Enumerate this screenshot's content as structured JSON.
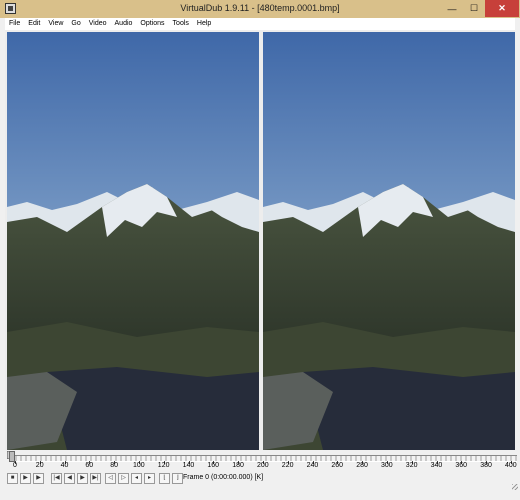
{
  "window": {
    "title": "VirtualDub 1.9.11 - [480temp.0001.bmp]",
    "minimize_glyph": "—",
    "maximize_glyph": "☐",
    "close_glyph": "✕"
  },
  "menu": [
    {
      "label": "File"
    },
    {
      "label": "Edit"
    },
    {
      "label": "View"
    },
    {
      "label": "Go"
    },
    {
      "label": "Video"
    },
    {
      "label": "Audio"
    },
    {
      "label": "Options"
    },
    {
      "label": "Tools"
    },
    {
      "label": "Help"
    }
  ],
  "panes": [
    {
      "name": "input-pane",
      "content": "mountain-lake-landscape"
    },
    {
      "name": "output-pane",
      "content": "mountain-lake-landscape"
    }
  ],
  "timeline": {
    "current_frame": 0,
    "max_frame": 400,
    "tick_labels": [
      "0",
      "20",
      "40",
      "60",
      "80",
      "100",
      "120",
      "140",
      "160",
      "180",
      "200",
      "220",
      "240",
      "260",
      "280",
      "300",
      "320",
      "340",
      "360",
      "380",
      "400"
    ]
  },
  "status": {
    "frame_text": "Frame 0 (0:00:00.000) [K]"
  },
  "toolbar": {
    "buttons": [
      {
        "name": "stop-button",
        "icon": "stop-icon",
        "glyph": "■"
      },
      {
        "name": "play-input-button",
        "icon": "play-input-icon",
        "glyph": "▶"
      },
      {
        "name": "play-output-button",
        "icon": "play-output-icon",
        "glyph": "▶"
      },
      {
        "name": "go-start-button",
        "icon": "go-start-icon",
        "glyph": "|◀"
      },
      {
        "name": "prev-frame-button",
        "icon": "prev-frame-icon",
        "glyph": "◀"
      },
      {
        "name": "next-frame-button",
        "icon": "next-frame-icon",
        "glyph": "▶"
      },
      {
        "name": "go-end-button",
        "icon": "go-end-icon",
        "glyph": "▶|"
      },
      {
        "name": "prev-key-button",
        "icon": "prev-key-icon",
        "glyph": "◁"
      },
      {
        "name": "next-key-button",
        "icon": "next-key-icon",
        "glyph": "▷"
      },
      {
        "name": "scene-rev-button",
        "icon": "scene-rev-icon",
        "glyph": "◂"
      },
      {
        "name": "scene-fwd-button",
        "icon": "scene-fwd-icon",
        "glyph": "▸"
      },
      {
        "name": "mark-in-button",
        "icon": "mark-in-icon",
        "glyph": "⌊"
      },
      {
        "name": "mark-out-button",
        "icon": "mark-out-icon",
        "glyph": "⌋"
      }
    ]
  },
  "colors": {
    "titlebar": "#d9c08a",
    "close_button": "#c7403a",
    "sky_top": "#3f68a8",
    "sky_bottom": "#b8cce0",
    "mountain_dark": "#3a4534",
    "snow": "#e8ecf0",
    "lake": "#2a3040"
  }
}
